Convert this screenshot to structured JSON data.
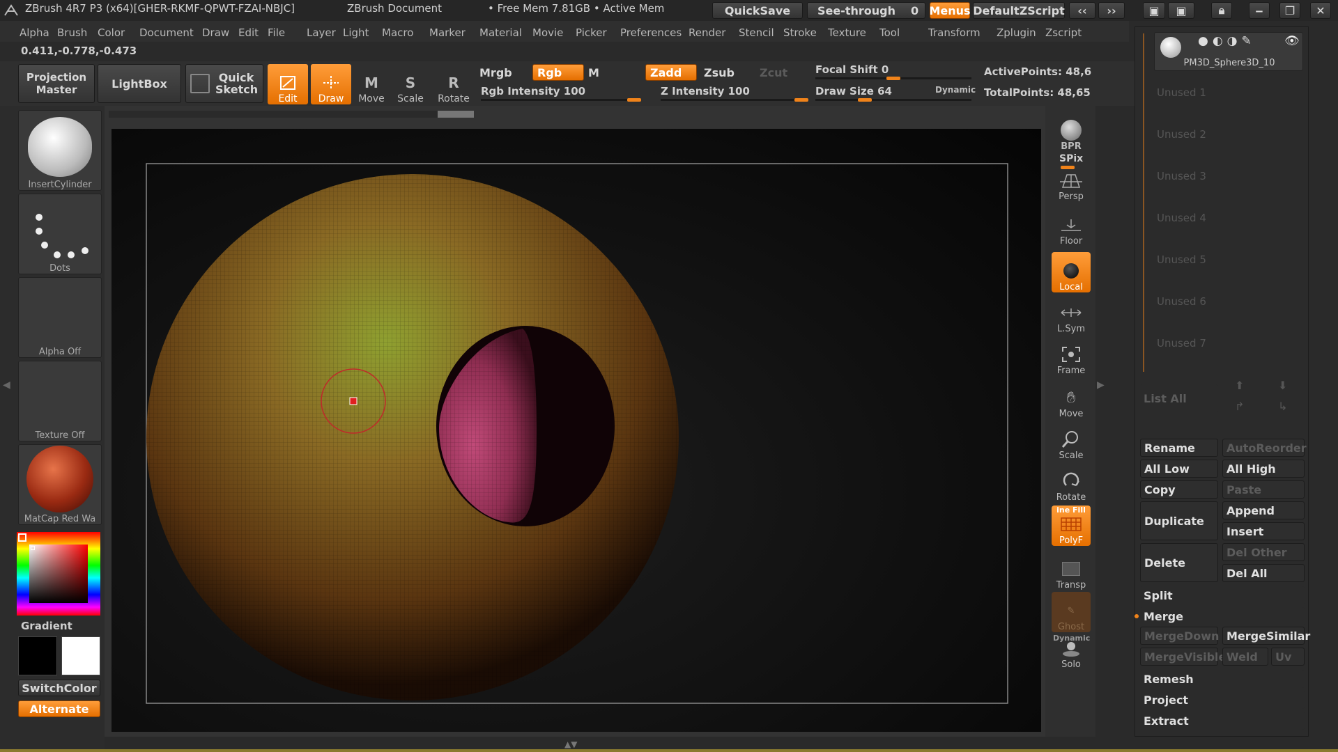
{
  "titlebar": {
    "app": "ZBrush 4R7 P3 (x64)[GHER-RKMF-QPWT-FZAI-NBJC]",
    "document": "ZBrush Document",
    "mem": "• Free Mem 7.81GB • Active Mem",
    "quicksave": "QuickSave",
    "see_through": "See-through",
    "see_through_value": "0",
    "menus": "Menus",
    "script": "DefaultZScript"
  },
  "menubar": [
    "Alpha",
    "Brush",
    "Color",
    "Document",
    "Draw",
    "Edit",
    "File",
    "Layer",
    "Light",
    "Macro",
    "Marker",
    "Material",
    "Movie",
    "Picker",
    "Preferences",
    "Render",
    "Stencil",
    "Stroke",
    "Texture",
    "Tool",
    "Transform",
    "Zplugin",
    "Zscript"
  ],
  "coords": "0.411,-0.778,-0.473",
  "toolbar": {
    "projection_master": "Projection Master",
    "lightbox": "LightBox",
    "quick_sketch": "Quick Sketch",
    "edit": "Edit",
    "draw": "Draw",
    "move": "Move",
    "scale": "Scale",
    "rotate": "Rotate",
    "mrgb": "Mrgb",
    "rgb": "Rgb",
    "m": "M",
    "zadd": "Zadd",
    "zsub": "Zsub",
    "zcut": "Zcut",
    "rgb_intensity": "Rgb Intensity 100",
    "z_intensity": "Z Intensity 100",
    "focal_shift": "Focal Shift 0",
    "draw_size": "Draw Size 64",
    "dynamic": "Dynamic",
    "active_points": "ActivePoints: 48,6",
    "total_points": "TotalPoints: 48,65",
    "rgb_intensity_level": 1.0,
    "z_intensity_level": 1.0,
    "focal_shift_level": 0.5,
    "draw_size_level": 0.3
  },
  "left_shelf": {
    "brush": "InsertCylinder",
    "stroke": "Dots",
    "alpha": "Alpha  Off",
    "texture": "Texture  Off",
    "material": "MatCap Red Wa",
    "gradient": "Gradient",
    "switch_color": "SwitchColor",
    "alternate": "Alternate"
  },
  "right_shelf": {
    "bpr": "BPR",
    "spix": "SPix",
    "persp": "Persp",
    "floor": "Floor",
    "local": "Local",
    "lsym": "L.Sym",
    "frame": "Frame",
    "move": "Move",
    "scale": "Scale",
    "rotate": "Rotate",
    "polyf": "PolyF",
    "transp": "Transp",
    "ghost": "Ghost",
    "solo": "Solo",
    "dynamic": "Dynamic",
    "line_fill": "ine Fill"
  },
  "subtool": {
    "current": "PM3D_Sphere3D_10",
    "slots": [
      "Unused 1",
      "Unused 2",
      "Unused 3",
      "Unused 4",
      "Unused 5",
      "Unused 6",
      "Unused 7"
    ],
    "list_all": "List  All",
    "rename": "Rename",
    "autoreorder": "AutoReorder",
    "all_low": "All Low",
    "all_high": "All High",
    "copy": "Copy",
    "paste": "Paste",
    "duplicate": "Duplicate",
    "append": "Append",
    "insert": "Insert",
    "delete": "Delete",
    "del_other": "Del Other",
    "del_all": "Del All",
    "split": "Split",
    "merge": "Merge",
    "merge_down": "MergeDown",
    "merge_similar": "MergeSimilar",
    "merge_visible": "MergeVisible",
    "weld": "Weld",
    "uv": "Uv",
    "remesh": "Remesh",
    "project": "Project",
    "extract": "Extract"
  },
  "colors": {
    "accent": "#f0831a",
    "sphere_a": "#8a7a2a",
    "sphere_b": "#5a3a12",
    "hole": "#b0406a"
  }
}
